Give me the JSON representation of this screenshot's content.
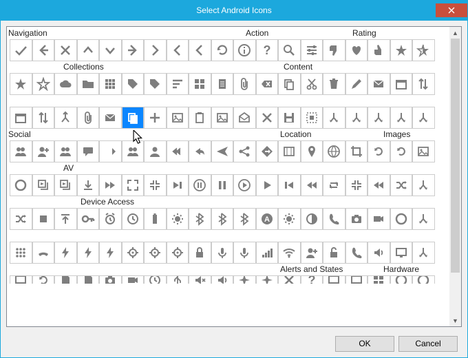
{
  "window": {
    "title": "Select Android Icons"
  },
  "buttons": {
    "ok": "OK",
    "cancel": "Cancel"
  },
  "sections": {
    "row0": [
      {
        "label": "Navigation",
        "pos": 0
      },
      {
        "label": "Action",
        "pos": 345
      },
      {
        "label": "Rating",
        "pos": 500
      }
    ],
    "row1": [
      {
        "label": "Collections",
        "pos": 80
      },
      {
        "label": "Content",
        "pos": 400
      }
    ],
    "row2": [
      {
        "label": "Social",
        "pos": 0
      },
      {
        "label": "Location",
        "pos": 395
      },
      {
        "label": "Images",
        "pos": 545
      }
    ],
    "row3": [
      {
        "label": "AV",
        "pos": 80
      }
    ],
    "row4": [
      {
        "label": "Device Access",
        "pos": 105
      }
    ],
    "row5": [
      {
        "label": "Alerts and States",
        "pos": 395
      },
      {
        "label": "Hardware",
        "pos": 545
      }
    ]
  },
  "iconGrid": {
    "rows": 10,
    "cols": 19,
    "selected": {
      "row": 2,
      "col": 5
    },
    "names": [
      [
        "nav-accept",
        "nav-back",
        "nav-cancel",
        "nav-collapse",
        "nav-expand",
        "nav-forward",
        "nav-next",
        "nav-prev",
        "nav-prev-item",
        "act-refresh",
        "act-about",
        "act-help",
        "act-search",
        "act-settings",
        "rate-bad",
        "rate-favorite",
        "rate-good",
        "rate-important",
        "rate-half"
      ],
      [
        "col-star",
        "col-star-outline",
        "col-cloud",
        "col-collection",
        "col-event",
        "col-labels",
        "col-new-label",
        "col-sort",
        "col-view-as-grid",
        "con-attachment",
        "con-backspace",
        "con-copy",
        "con-cut",
        "con-discard",
        "con-edit",
        "con-email",
        "con-event",
        "con-import-export",
        "con-merge"
      ],
      [
        "con-new-attachment",
        "con-new-email",
        "con-new-event",
        "con-new-picture",
        "con-new",
        "con-paste",
        "con-picture",
        "con-read",
        "con-remove",
        "con-save",
        "con-select-all",
        "con-split",
        "con-undo",
        "con-unread",
        "blank",
        "blank",
        "blank",
        "blank",
        "blank"
      ],
      [
        "soc-add-group",
        "soc-add-person",
        "soc-group",
        "soc-chat",
        "soc-forward",
        "soc-cc",
        "soc-person",
        "soc-reply-all",
        "soc-reply",
        "soc-send",
        "soc-share",
        "loc-directions",
        "loc-map",
        "loc-place",
        "loc-web",
        "img-crop",
        "img-rotate-left",
        "img-rotate-right",
        "img-slideshow"
      ],
      [
        "av-add-queue",
        "av-replay",
        "av-download",
        "av-fast-forward",
        "av-full-screen",
        "av-available-offline",
        "av-next",
        "av-pause-circle",
        "av-pause",
        "av-play-circle",
        "av-play",
        "av-previous",
        "av-repeat",
        "av-return-full",
        "av-rewind",
        "av-shuffle",
        "av-stop",
        "av-upload",
        "blank"
      ],
      [
        "dev-shuffle",
        "dev-stop",
        "dev-upload",
        "dev-access",
        "dev-add-alarm",
        "dev-alarms",
        "dev-battery",
        "dev-brightness-hi",
        "dev-bluetooth",
        "dev-bluetooth-conn",
        "dev-bluetooth-search",
        "dev-brightness-auto",
        "dev-brightness-med",
        "dev-brightness-low",
        "dev-call",
        "dev-camera",
        "dev-video",
        "dev-data-usage",
        "blank"
      ],
      [
        "dev-dial-pad",
        "dev-end-call",
        "dev-flash-auto",
        "dev-flash-off",
        "dev-flash-on",
        "dev-gps-found",
        "dev-gps-off",
        "dev-gps-search",
        "dev-secure",
        "dev-mic",
        "dev-mic-muted",
        "dev-cell",
        "dev-wifi",
        "dev-new-account",
        "dev-not-secure",
        "dev-make-call",
        "dev-ring-volume",
        "dev-screen-lock-land",
        "blank"
      ],
      [
        "dev-screen-lock-port",
        "dev-screen-rot",
        "dev-sd-storage",
        "dev-storage",
        "dev-switch-camera",
        "dev-switch-video",
        "dev-time",
        "dev-usb",
        "dev-volume-muted",
        "dev-volume-on",
        "alert-airplane-off",
        "alert-airplane-on",
        "alert-error",
        "alert-warning",
        "hw-computer",
        "hw-dock",
        "hw-gamepad",
        "hw-headphones",
        "hw-headset"
      ]
    ]
  }
}
